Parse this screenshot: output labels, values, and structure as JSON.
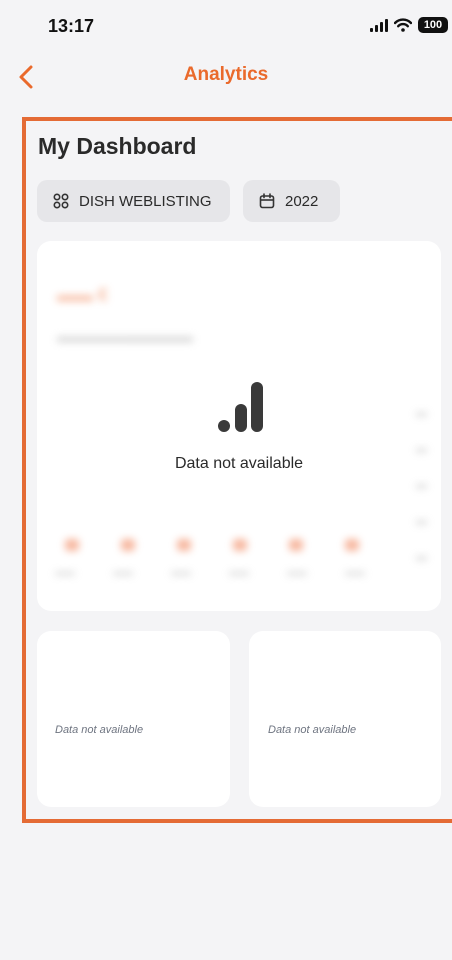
{
  "status": {
    "time": "13:17",
    "battery": "100"
  },
  "nav": {
    "title": "Analytics"
  },
  "dashboard": {
    "title": "My Dashboard",
    "business_filter": "DISH WEBLISTING",
    "year_filter": "2022"
  },
  "main_chart": {
    "empty_text": "Data not available"
  },
  "cards": {
    "left_empty_text": "Data not available",
    "right_empty_text": "Data not available"
  },
  "colors": {
    "accent": "#ea6a2c",
    "frame": "#e46b35"
  }
}
